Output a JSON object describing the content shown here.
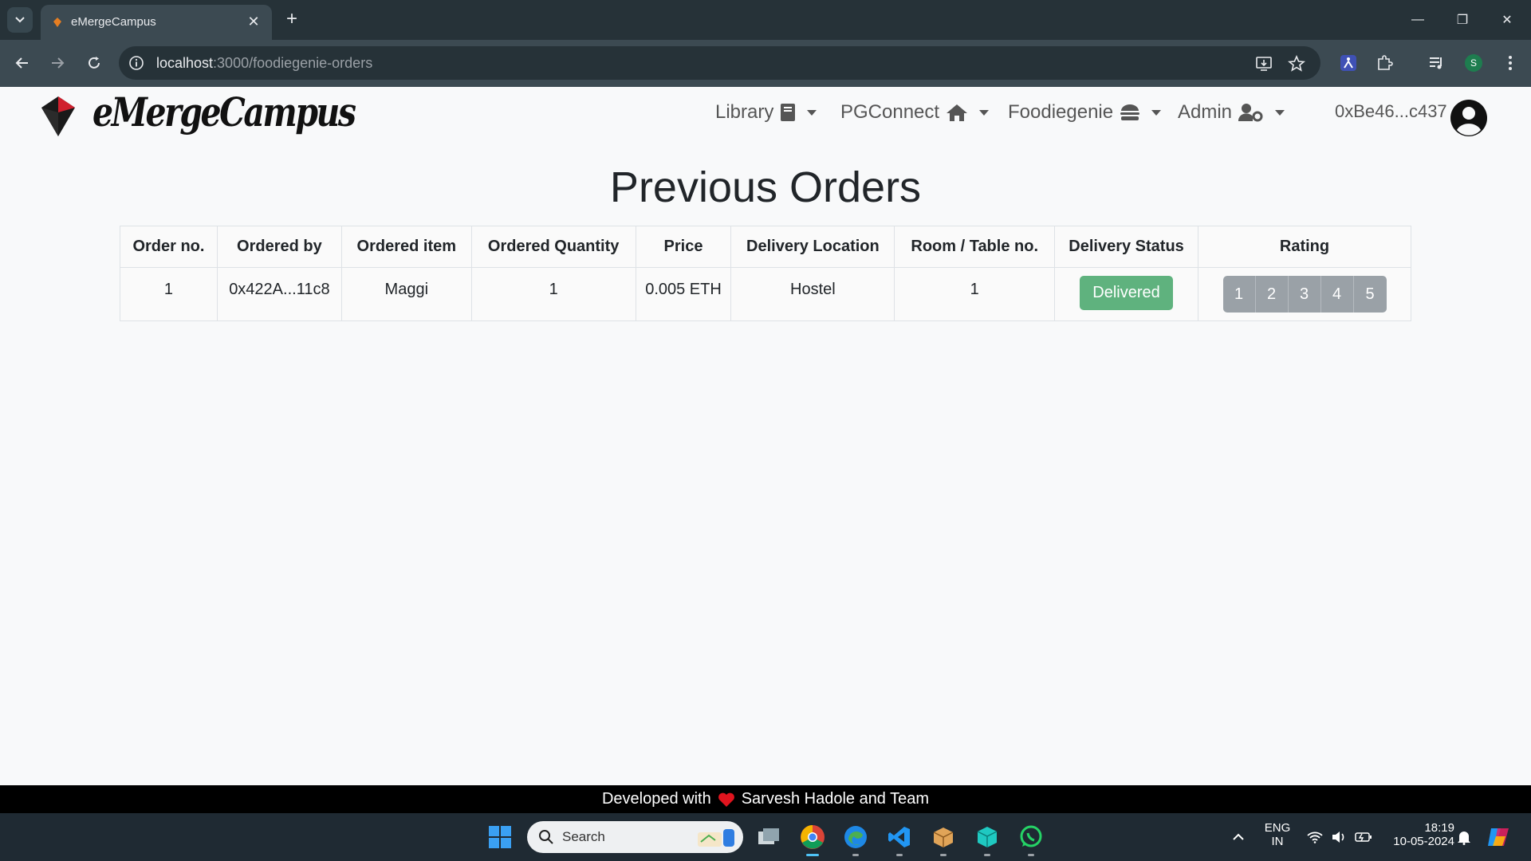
{
  "browser": {
    "tab_title": "eMergeCampus",
    "url_host": "localhost",
    "url_path": ":3000/foodiegenie-orders",
    "profile_initial": "S"
  },
  "navbar": {
    "brand": "eMergeCampus",
    "items": [
      {
        "label": "Library",
        "icon": "book-icon"
      },
      {
        "label": "PGConnect",
        "icon": "home-icon"
      },
      {
        "label": "Foodiegenie",
        "icon": "burger-icon"
      },
      {
        "label": "Admin",
        "icon": "user-gear-icon"
      }
    ],
    "account": "0xBe46...c437"
  },
  "main": {
    "title": "Previous Orders",
    "table": {
      "headers": [
        "Order no.",
        "Ordered by",
        "Ordered item",
        "Ordered Quantity",
        "Price",
        "Delivery Location",
        "Room / Table no.",
        "Delivery Status",
        "Rating"
      ],
      "rows": [
        {
          "order_no": "1",
          "ordered_by": "0x422A...11c8",
          "item": "Maggi",
          "quantity": "1",
          "price": "0.005 ETH",
          "location": "Hostel",
          "room": "1",
          "status": "Delivered",
          "ratings": [
            "1",
            "2",
            "3",
            "4",
            "5"
          ]
        }
      ]
    }
  },
  "footer": {
    "prefix": "Developed with",
    "suffix": "Sarvesh Hadole and Team"
  },
  "taskbar": {
    "search_label": "Search",
    "lang_line1": "ENG",
    "lang_line2": "IN",
    "time": "18:19",
    "date": "10-05-2024"
  },
  "colors": {
    "delivered": "#5fb27e",
    "rating_button": "#9aa1a7",
    "chrome_dark": "#263238",
    "toolbar": "#3c4a52"
  }
}
